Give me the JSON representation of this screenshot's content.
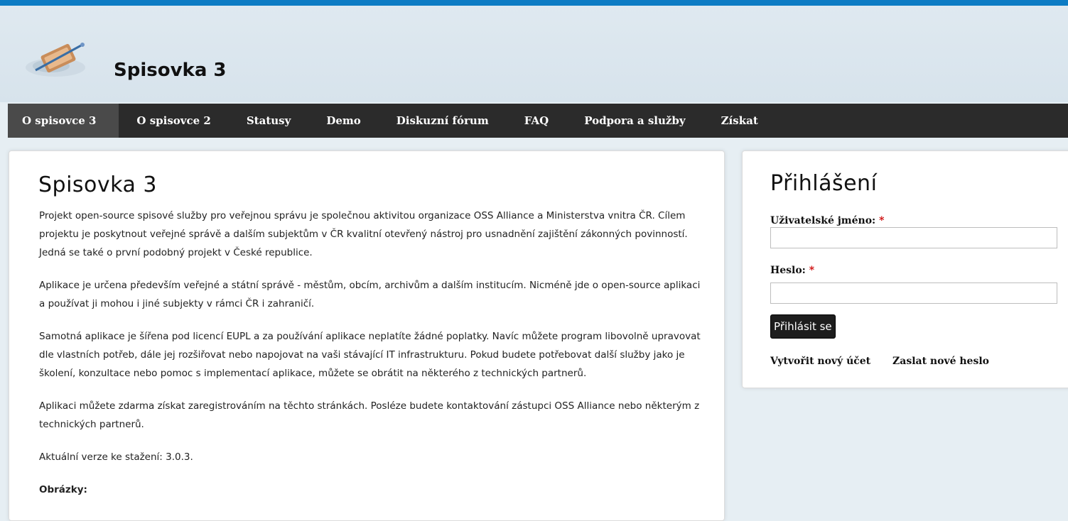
{
  "site": {
    "name": "Spisovka 3"
  },
  "nav": {
    "items": [
      {
        "label": "O spisovce 3"
      },
      {
        "label": "O spisovce 2"
      },
      {
        "label": "Statusy"
      },
      {
        "label": "Demo"
      },
      {
        "label": "Diskuzní fórum"
      },
      {
        "label": "FAQ"
      },
      {
        "label": "Podpora a služby"
      },
      {
        "label": "Získat"
      }
    ]
  },
  "main": {
    "title": "Spisovka 3",
    "paragraphs": [
      "Projekt open-source spisové služby pro veřejnou správu je společnou aktivitou organizace OSS Alliance a Ministerstva vnitra ČR. Cílem projektu je poskytnout veřejné správě a dalším subjektům v ČR kvalitní otevřený nástroj pro usnadnění zajištění zákonných povinností. Jedná se také o první podobný projekt v České republice.",
      "Aplikace je určena především veřejné a státní správě - městům, obcím, archivům a dalším institucím. Nicméně jde o open-source aplikaci a používat ji mohou i jiné subjekty v rámci ČR i zahraničí.",
      "Samotná aplikace je šířena pod licencí EUPL a za používání aplikace neplatíte žádné poplatky. Navíc můžete program libovolně upravovat dle vlastních potřeb, dále jej rozšiřovat nebo napojovat na vaši stávající IT infrastrukturu. Pokud budete potřebovat další služby jako je školení, konzultace nebo pomoc s implementací aplikace, můžete se obrátit na některého z technických partnerů.",
      "Aplikaci můžete zdarma získat zaregistrováním na těchto stránkách. Posléze budete kontaktování zástupci OSS Alliance nebo některým z technických partnerů.",
      "Aktuální verze ke stažení: 3.0.3."
    ],
    "images_label": "Obrázky:"
  },
  "login": {
    "title": "Přihlášení",
    "username_label": "Uživatelské jméno:",
    "password_label": "Heslo:",
    "required_mark": "*",
    "username_value": "",
    "password_value": "",
    "submit_label": "Přihlásit se",
    "create_account": "Vytvořit nový účet",
    "new_password": "Zaslat nové heslo"
  },
  "colors": {
    "accent": "#0d7cc4",
    "nav_bg": "#2b2b2b",
    "nav_active": "#4a4a4a",
    "required": "#cc0000"
  }
}
